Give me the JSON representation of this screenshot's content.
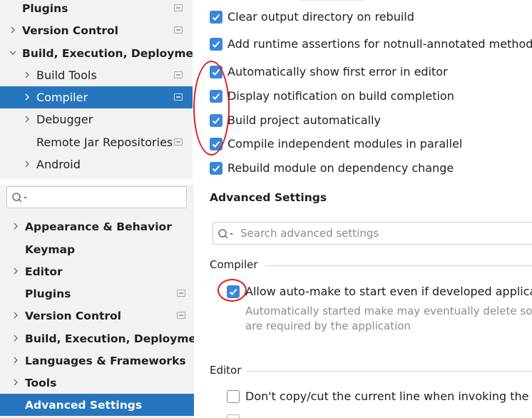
{
  "top": {
    "sidebar": {
      "items": [
        {
          "label": "Plugins"
        },
        {
          "label": "Version Control"
        },
        {
          "label": "Build, Execution, Deployment"
        },
        {
          "label": "Build Tools"
        },
        {
          "label": "Compiler"
        },
        {
          "label": "Debugger"
        },
        {
          "label": "Remote Jar Repositories"
        },
        {
          "label": "Android"
        }
      ]
    },
    "options": [
      {
        "label": "Clear output directory on rebuild",
        "checked": true
      },
      {
        "label": "Add runtime assertions for notnull-annotated methods and",
        "checked": true
      },
      {
        "label": "Automatically show first error in editor",
        "checked": true
      },
      {
        "label": "Display notification on build completion",
        "checked": true
      },
      {
        "label": "Build project automatically",
        "checked": true
      },
      {
        "label": "Compile independent modules in parallel",
        "checked": true
      },
      {
        "label": "Rebuild module on dependency change",
        "checked": true
      }
    ]
  },
  "bottom": {
    "sidebar": {
      "search_placeholder": "",
      "items": [
        {
          "label": "Appearance & Behavior"
        },
        {
          "label": "Keymap"
        },
        {
          "label": "Editor"
        },
        {
          "label": "Plugins"
        },
        {
          "label": "Version Control"
        },
        {
          "label": "Build, Execution, Deployment"
        },
        {
          "label": "Languages & Frameworks"
        },
        {
          "label": "Tools"
        },
        {
          "label": "Advanced Settings"
        }
      ]
    },
    "content": {
      "title": "Advanced Settings",
      "search_placeholder": "Search advanced settings",
      "compiler_section": "Compiler",
      "automake_label": "Allow auto-make to start even if developed application",
      "automake_desc_line1": "Automatically started make may eventually delete some",
      "automake_desc_line2": "are required by the application",
      "editor_section": "Editor",
      "copy_label": "Don't copy/cut the current line when invoking the Copy"
    }
  },
  "colors": {
    "accent": "#2675bf",
    "checkbox": "#3b86db",
    "annotation": "#e01b1b"
  }
}
